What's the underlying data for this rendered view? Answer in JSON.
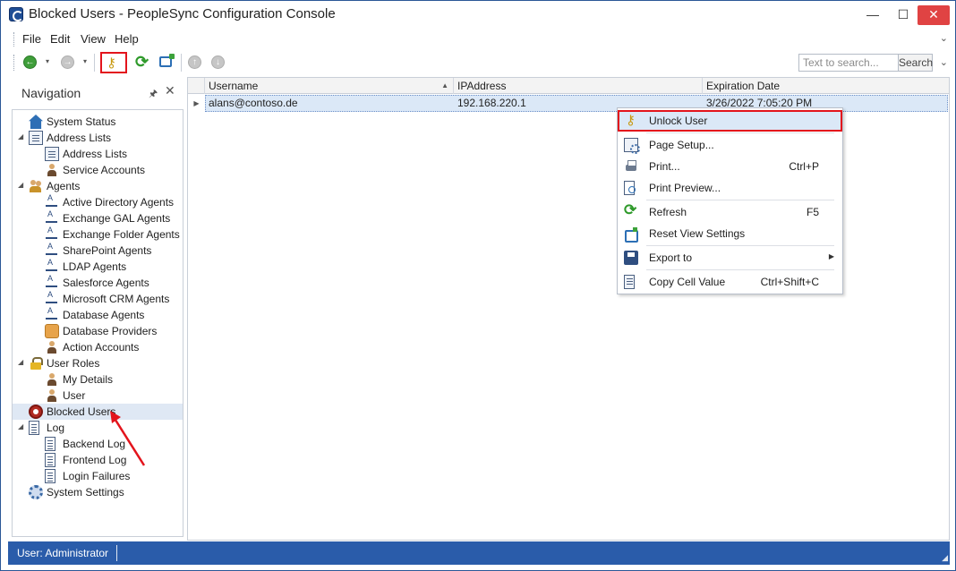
{
  "window": {
    "title": "Blocked Users - PeopleSync Configuration Console",
    "minimize": "—",
    "maximize": "☐",
    "close": "✕"
  },
  "menu": {
    "items": [
      "File",
      "Edit",
      "View",
      "Help"
    ],
    "overflow": "⌄"
  },
  "toolbar": {
    "search_placeholder": "Text to search...",
    "search_button": "Search",
    "overflow": "⌄",
    "back_glyph": "←",
    "forward_glyph": "→",
    "unlock_glyph": "⚷",
    "refresh_glyph": "⟳",
    "up_glyph": "↑",
    "down_glyph": "↓",
    "dropdown_caret": "▾"
  },
  "navigation": {
    "title": "Navigation",
    "pin": "🖈",
    "close": "✕",
    "tree": [
      {
        "label": "System Status",
        "level": 0,
        "expander": "",
        "icon": "house-icon",
        "selected": false
      },
      {
        "label": "Address Lists",
        "level": 0,
        "expander": "◢",
        "icon": "address-book-icon",
        "selected": false
      },
      {
        "label": "Address Lists",
        "level": 1,
        "expander": "",
        "icon": "address-book-icon",
        "selected": false
      },
      {
        "label": "Service Accounts",
        "level": 1,
        "expander": "",
        "icon": "person-icon",
        "selected": false
      },
      {
        "label": "Agents",
        "level": 0,
        "expander": "◢",
        "icon": "group-icon",
        "selected": false
      },
      {
        "label": "Active Directory Agents",
        "level": 1,
        "expander": "",
        "icon": "agent-icon",
        "selected": false
      },
      {
        "label": "Exchange GAL Agents",
        "level": 1,
        "expander": "",
        "icon": "agent-icon",
        "selected": false
      },
      {
        "label": "Exchange Folder Agents",
        "level": 1,
        "expander": "",
        "icon": "agent-icon",
        "selected": false
      },
      {
        "label": "SharePoint Agents",
        "level": 1,
        "expander": "",
        "icon": "agent-icon",
        "selected": false
      },
      {
        "label": "LDAP Agents",
        "level": 1,
        "expander": "",
        "icon": "agent-icon",
        "selected": false
      },
      {
        "label": "Salesforce Agents",
        "level": 1,
        "expander": "",
        "icon": "agent-icon",
        "selected": false
      },
      {
        "label": "Microsoft CRM Agents",
        "level": 1,
        "expander": "",
        "icon": "agent-icon",
        "selected": false
      },
      {
        "label": "Database Agents",
        "level": 1,
        "expander": "",
        "icon": "agent-icon",
        "selected": false
      },
      {
        "label": "Database Providers",
        "level": 1,
        "expander": "",
        "icon": "database-icon",
        "selected": false
      },
      {
        "label": "Action Accounts",
        "level": 1,
        "expander": "",
        "icon": "person-icon",
        "selected": false
      },
      {
        "label": "User Roles",
        "level": 0,
        "expander": "◢",
        "icon": "lock-icon",
        "selected": false
      },
      {
        "label": "My Details",
        "level": 1,
        "expander": "",
        "icon": "person-icon",
        "selected": false
      },
      {
        "label": "User",
        "level": 1,
        "expander": "",
        "icon": "person-icon",
        "selected": false
      },
      {
        "label": "Blocked Users",
        "level": 0,
        "expander": "",
        "icon": "blocked-icon",
        "selected": true
      },
      {
        "label": "Log",
        "level": 0,
        "expander": "◢",
        "icon": "page-icon",
        "selected": false
      },
      {
        "label": "Backend Log",
        "level": 1,
        "expander": "",
        "icon": "page-icon",
        "selected": false
      },
      {
        "label": "Frontend Log",
        "level": 1,
        "expander": "",
        "icon": "page-icon",
        "selected": false
      },
      {
        "label": "Login Failures",
        "level": 1,
        "expander": "",
        "icon": "page-icon",
        "selected": false
      },
      {
        "label": "System Settings",
        "level": 0,
        "expander": "",
        "icon": "gear-icon",
        "selected": false
      }
    ]
  },
  "grid": {
    "columns": [
      "Username",
      "IPAddress",
      "Expiration Date"
    ],
    "sort_arrow": "▲",
    "row_indicator": "▶",
    "rows": [
      {
        "username": "alans@contoso.de",
        "ip": "192.168.220.1",
        "expiration": "3/26/2022 7:05:20 PM"
      }
    ]
  },
  "context_menu": {
    "items": [
      {
        "label": "Unlock User",
        "shortcut": "",
        "icon": "key-icon",
        "highlighted": true,
        "submenu": false
      },
      {
        "label": "Page Setup...",
        "shortcut": "",
        "icon": "page-setup-icon",
        "highlighted": false,
        "submenu": false
      },
      {
        "label": "Print...",
        "shortcut": "Ctrl+P",
        "icon": "printer-icon",
        "highlighted": false,
        "submenu": false
      },
      {
        "label": "Print Preview...",
        "shortcut": "",
        "icon": "print-preview-icon",
        "highlighted": false,
        "submenu": false
      },
      {
        "label": "Refresh",
        "shortcut": "F5",
        "icon": "refresh-icon",
        "highlighted": false,
        "submenu": false
      },
      {
        "label": "Reset View Settings",
        "shortcut": "",
        "icon": "reset-view-icon",
        "highlighted": false,
        "submenu": false
      },
      {
        "label": "Export to",
        "shortcut": "",
        "icon": "export-icon",
        "highlighted": false,
        "submenu": true
      },
      {
        "label": "Copy Cell Value",
        "shortcut": "Ctrl+Shift+C",
        "icon": "copy-icon",
        "highlighted": false,
        "submenu": false
      }
    ],
    "submenu_arrow": "▶"
  },
  "status": {
    "user": "User: Administrator",
    "grip": "◢"
  },
  "colors": {
    "accent": "#2a5caa",
    "highlight_border": "#e3141c",
    "selection": "#dbe8f7",
    "close_button": "#e04343"
  }
}
